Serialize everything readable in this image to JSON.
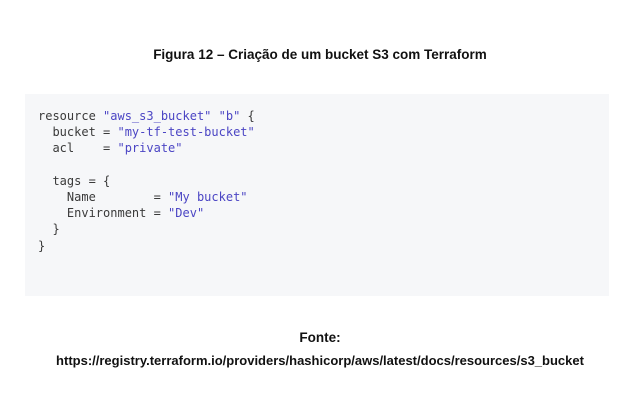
{
  "caption": "Figura 12 – Criação de um bucket S3 com Terraform",
  "code": {
    "lines": [
      {
        "plain": "resource ",
        "str": "\"aws_s3_bucket\" \"b\"",
        "tail": " {"
      },
      {
        "plain": "  bucket = ",
        "str": "\"my-tf-test-bucket\"",
        "tail": ""
      },
      {
        "plain": "  acl    = ",
        "str": "\"private\"",
        "tail": ""
      },
      {
        "plain": "",
        "str": "",
        "tail": ""
      },
      {
        "plain": "  tags = {",
        "str": "",
        "tail": ""
      },
      {
        "plain": "    Name        = ",
        "str": "\"My bucket\"",
        "tail": ""
      },
      {
        "plain": "    Environment = ",
        "str": "\"Dev\"",
        "tail": ""
      },
      {
        "plain": "  }",
        "str": "",
        "tail": ""
      },
      {
        "plain": "}",
        "str": "",
        "tail": ""
      }
    ]
  },
  "footer": {
    "label": "Fonte:",
    "url": "https://registry.terraform.io/providers/hashicorp/aws/latest/docs/resources/s3_bucket"
  },
  "colors": {
    "string": "#4b45c4",
    "code_background": "#f6f7f9",
    "code_text": "#3a3a3a"
  }
}
